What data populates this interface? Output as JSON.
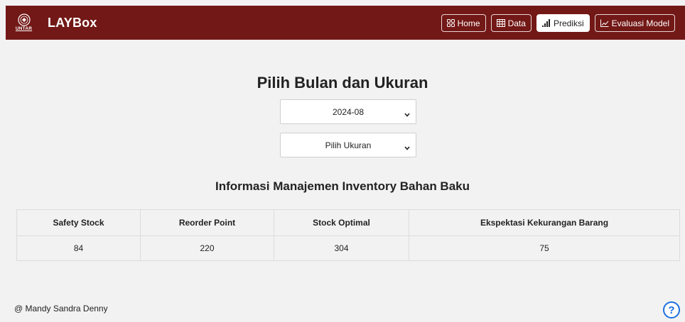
{
  "app": {
    "brand_name": "LAYBox",
    "logo_text": "UNTAR",
    "logo_icon": "university-seal-icon"
  },
  "nav": {
    "items": [
      {
        "label": "Home",
        "icon": "grid-icon",
        "active": false
      },
      {
        "label": "Data",
        "icon": "table-icon",
        "active": false
      },
      {
        "label": "Prediksi",
        "icon": "bar-chart-icon",
        "active": true
      },
      {
        "label": "Evaluasi Model",
        "icon": "line-chart-icon",
        "active": false
      }
    ]
  },
  "main": {
    "title": "Pilih Bulan dan Ukuran",
    "month_select": {
      "value": "2024-08"
    },
    "size_select": {
      "value": "Pilih Ukuran"
    },
    "info_title": "Informasi Manajemen Inventory Bahan Baku",
    "table": {
      "headers": [
        "Safety Stock",
        "Reorder Point",
        "Stock Optimal",
        "Ekspektasi Kekurangan Barang"
      ],
      "rows": [
        [
          "84",
          "220",
          "304",
          "75"
        ]
      ]
    }
  },
  "footer": {
    "text": "@ Mandy Sandra Denny",
    "help_label": "?"
  },
  "colors": {
    "navbar": "#721816",
    "background": "#f2f2f2",
    "help_accent": "#1c6fe0"
  }
}
